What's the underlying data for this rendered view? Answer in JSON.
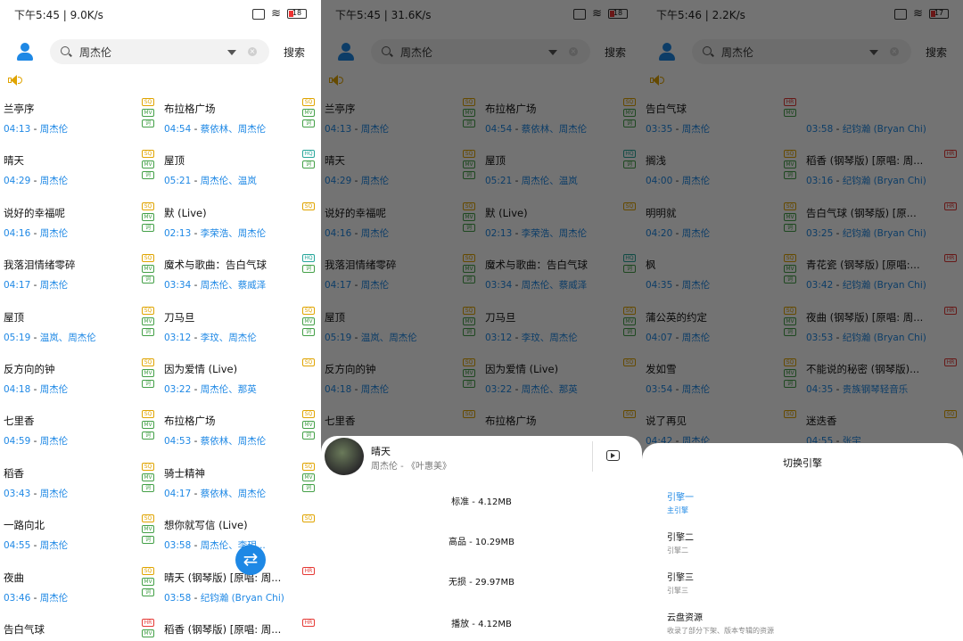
{
  "colors": {
    "accent": "#1e88e5",
    "sq": "#e0a400",
    "hq": "#26a69a",
    "hr": "#e53935",
    "mv": "#43a047"
  },
  "icons": {
    "avatar": "user-icon",
    "search": "search-icon",
    "dropdown": "chevron-down-icon",
    "clear": "clear-icon",
    "speaker": "speaker-icon",
    "swap": "swap-arrows-icon",
    "play": "play-video-icon"
  },
  "screens": [
    {
      "status": {
        "text": "下午5:45 | 9.0K/s",
        "battery": "18"
      },
      "search": {
        "query": "周杰伦",
        "button": "搜索"
      },
      "songs": [
        {
          "title": "兰亭序",
          "time": "04:13",
          "artist": "周杰伦",
          "badges": [
            "SQ",
            "MV",
            "ZH"
          ]
        },
        {
          "title": "布拉格广场",
          "time": "04:54",
          "artist": "蔡依林、周杰伦",
          "badges": [
            "SQ",
            "MV",
            "ZH"
          ]
        },
        {
          "title": "晴天",
          "time": "04:29",
          "artist": "周杰伦",
          "badges": [
            "SQ",
            "MV",
            "ZH"
          ]
        },
        {
          "title": "屋顶",
          "time": "05:21",
          "artist": "周杰伦、温岚",
          "badges": [
            "HQ",
            "ZH"
          ]
        },
        {
          "title": "说好的幸福呢",
          "time": "04:16",
          "artist": "周杰伦",
          "badges": [
            "SQ",
            "MV",
            "ZH"
          ]
        },
        {
          "title": "默 (Live)",
          "time": "02:13",
          "artist": "李荣浩、周杰伦",
          "badges": [
            "SQ"
          ]
        },
        {
          "title": "我落泪情绪零碎",
          "time": "04:17",
          "artist": "周杰伦",
          "badges": [
            "SQ",
            "MV",
            "ZH"
          ]
        },
        {
          "title": "魔术与歌曲：告白气球",
          "time": "03:34",
          "artist": "周杰伦、蔡威泽",
          "badges": [
            "HQ",
            "ZH"
          ]
        },
        {
          "title": "屋顶",
          "time": "05:19",
          "artist": "温岚、周杰伦",
          "badges": [
            "SQ",
            "MV",
            "ZH"
          ]
        },
        {
          "title": "刀马旦",
          "time": "03:12",
          "artist": "李玟、周杰伦",
          "badges": [
            "SQ",
            "MV",
            "ZH"
          ]
        },
        {
          "title": "反方向的钟",
          "time": "04:18",
          "artist": "周杰伦",
          "badges": [
            "SQ",
            "MV",
            "ZH"
          ]
        },
        {
          "title": "因为爱情 (Live)",
          "time": "03:22",
          "artist": "周杰伦、那英",
          "badges": [
            "SQ"
          ]
        },
        {
          "title": "七里香",
          "time": "04:59",
          "artist": "周杰伦",
          "badges": [
            "SQ",
            "MV",
            "ZH"
          ]
        },
        {
          "title": "布拉格广场",
          "time": "04:53",
          "artist": "蔡依林、周杰伦",
          "badges": [
            "SQ",
            "MV",
            "ZH"
          ]
        },
        {
          "title": "稻香",
          "time": "03:43",
          "artist": "周杰伦",
          "badges": [
            "SQ",
            "MV",
            "ZH"
          ]
        },
        {
          "title": "骑士精神",
          "time": "04:17",
          "artist": "蔡依林、周杰伦",
          "badges": [
            "SQ",
            "MV",
            "ZH"
          ]
        },
        {
          "title": "一路向北",
          "time": "04:55",
          "artist": "周杰伦",
          "badges": [
            "SQ",
            "MV",
            "ZH"
          ]
        },
        {
          "title": "想你就写信 (Live)",
          "time": "03:58",
          "artist": "周杰伦、李玥...",
          "badges": [
            "SQ"
          ]
        },
        {
          "title": "夜曲",
          "time": "03:46",
          "artist": "周杰伦",
          "badges": [
            "SQ",
            "MV",
            "ZH"
          ]
        },
        {
          "title": "晴天 (钢琴版) [原唱: 周...",
          "time": "03:58",
          "artist": "纪钧瀚 (Bryan Chi)",
          "badges": [
            "HR"
          ]
        },
        {
          "title": "告白气球",
          "time": "",
          "artist": "",
          "badges": [
            "HR",
            "MV"
          ]
        },
        {
          "title": "稻香 (钢琴版) [原唱: 周...",
          "time": "",
          "artist": "",
          "badges": [
            "HR"
          ]
        }
      ]
    },
    {
      "status": {
        "text": "下午5:45 | 31.6K/s",
        "battery": "18"
      },
      "search": {
        "query": "周杰伦",
        "button": "搜索"
      },
      "songs": [
        {
          "title": "兰亭序",
          "time": "04:13",
          "artist": "周杰伦",
          "badges": [
            "SQ",
            "MV",
            "ZH"
          ]
        },
        {
          "title": "布拉格广场",
          "time": "04:54",
          "artist": "蔡依林、周杰伦",
          "badges": [
            "SQ",
            "MV",
            "ZH"
          ]
        },
        {
          "title": "晴天",
          "time": "04:29",
          "artist": "周杰伦",
          "badges": [
            "SQ",
            "MV",
            "ZH"
          ]
        },
        {
          "title": "屋顶",
          "time": "05:21",
          "artist": "周杰伦、温岚",
          "badges": [
            "HQ",
            "ZH"
          ]
        },
        {
          "title": "说好的幸福呢",
          "time": "04:16",
          "artist": "周杰伦",
          "badges": [
            "SQ",
            "MV",
            "ZH"
          ]
        },
        {
          "title": "默 (Live)",
          "time": "02:13",
          "artist": "李荣浩、周杰伦",
          "badges": [
            "SQ"
          ]
        },
        {
          "title": "我落泪情绪零碎",
          "time": "04:17",
          "artist": "周杰伦",
          "badges": [
            "SQ",
            "MV",
            "ZH"
          ]
        },
        {
          "title": "魔术与歌曲：告白气球",
          "time": "03:34",
          "artist": "周杰伦、蔡威泽",
          "badges": [
            "HQ",
            "ZH"
          ]
        },
        {
          "title": "屋顶",
          "time": "05:19",
          "artist": "温岚、周杰伦",
          "badges": [
            "SQ",
            "MV",
            "ZH"
          ]
        },
        {
          "title": "刀马旦",
          "time": "03:12",
          "artist": "李玟、周杰伦",
          "badges": [
            "SQ",
            "MV",
            "ZH"
          ]
        },
        {
          "title": "反方向的钟",
          "time": "04:18",
          "artist": "周杰伦",
          "badges": [
            "SQ",
            "MV",
            "ZH"
          ]
        },
        {
          "title": "因为爱情 (Live)",
          "time": "03:22",
          "artist": "周杰伦、那英",
          "badges": [
            "SQ"
          ]
        },
        {
          "title": "七里香",
          "time": "",
          "artist": "",
          "badges": [
            "SQ"
          ]
        },
        {
          "title": "布拉格广场",
          "time": "",
          "artist": "",
          "badges": [
            "SQ"
          ]
        }
      ],
      "now_playing": {
        "title": "晴天",
        "subtitle": "周杰伦 - 《叶惠美》"
      },
      "qualities": [
        "标准 - 4.12MB",
        "高品 - 10.29MB",
        "无损 - 29.97MB",
        "播放 - 4.12MB"
      ]
    },
    {
      "status": {
        "text": "下午5:46 | 2.2K/s",
        "battery": "17"
      },
      "search": {
        "query": "周杰伦",
        "button": "搜索"
      },
      "songs": [
        {
          "title": "告白气球",
          "time": "03:35",
          "artist": "周杰伦",
          "badges": [
            "HR",
            "MV"
          ]
        },
        {
          "title": "",
          "time": "03:58",
          "artist": "纪钧瀚 (Bryan Chi)",
          "badges": []
        },
        {
          "title": "搁浅",
          "time": "04:00",
          "artist": "周杰伦",
          "badges": [
            "SQ",
            "MV",
            "ZH"
          ]
        },
        {
          "title": "稻香 (钢琴版) [原唱: 周...",
          "time": "03:16",
          "artist": "纪钧瀚 (Bryan Chi)",
          "badges": [
            "HR"
          ]
        },
        {
          "title": "明明就",
          "time": "04:20",
          "artist": "周杰伦",
          "badges": [
            "SQ",
            "MV",
            "ZH"
          ]
        },
        {
          "title": "告白气球 (钢琴版) [原...",
          "time": "03:25",
          "artist": "纪钧瀚 (Bryan Chi)",
          "badges": [
            "HR"
          ]
        },
        {
          "title": "枫",
          "time": "04:35",
          "artist": "周杰伦",
          "badges": [
            "SQ",
            "MV",
            "ZH"
          ]
        },
        {
          "title": "青花瓷 (钢琴版) [原唱:...",
          "time": "03:42",
          "artist": "纪钧瀚 (Bryan Chi)",
          "badges": [
            "HR"
          ]
        },
        {
          "title": "蒲公英的约定",
          "time": "04:07",
          "artist": "周杰伦",
          "badges": [
            "SQ",
            "MV",
            "ZH"
          ]
        },
        {
          "title": "夜曲 (钢琴版) [原唱: 周...",
          "time": "03:53",
          "artist": "纪钧瀚 (Bryan Chi)",
          "badges": [
            "HR"
          ]
        },
        {
          "title": "发如雪",
          "time": "03:54",
          "artist": "周杰伦",
          "badges": [
            "SQ",
            "MV",
            "ZH"
          ]
        },
        {
          "title": "不能说的秘密 (钢琴版)...",
          "time": "04:35",
          "artist": "贵族钢琴轻音乐",
          "badges": [
            "HR"
          ]
        },
        {
          "title": "说了再见",
          "time": "04:42",
          "artist": "周杰伦",
          "badges": [
            "SQ"
          ]
        },
        {
          "title": "迷迭香",
          "time": "04:55",
          "artist": "张宇",
          "badges": [
            "SQ"
          ]
        }
      ],
      "engine_sheet": {
        "title": "切换引擎",
        "engines": [
          {
            "name": "引擎一",
            "desc": "主引擎",
            "active": true
          },
          {
            "name": "引擎二",
            "desc": "引擎二",
            "active": false
          },
          {
            "name": "引擎三",
            "desc": "引擎三",
            "active": false
          },
          {
            "name": "云盘资源",
            "desc": "收录了部分下架、版本专辑的资源",
            "active": false
          }
        ]
      }
    }
  ]
}
